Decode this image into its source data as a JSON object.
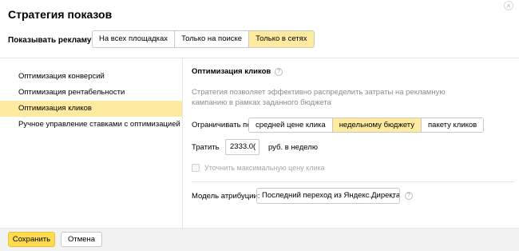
{
  "dialog": {
    "title": "Стратегия показов",
    "close_glyph": "×"
  },
  "placement": {
    "label": "Показывать рекламу:",
    "options": [
      "На всех площадках",
      "Только на поиске",
      "Только в сетях"
    ],
    "selected": "Только в сетях"
  },
  "sidebar": {
    "items": [
      {
        "label": "Оптимизация конверсий"
      },
      {
        "label": "Оптимизация рентабельности"
      },
      {
        "label": "Оптимизация кликов"
      },
      {
        "label": "Ручное управление ставками с оптимизацией"
      }
    ],
    "selected": "Оптимизация кликов"
  },
  "content": {
    "title": "Оптимизация кликов",
    "help_glyph": "?",
    "description": "Стратегия позволяет эффективно распределить затраты на рекламную кампанию в рамках заданного бюджета",
    "limit": {
      "label": "Ограничивать по",
      "options": [
        "средней цене клика",
        "недельному бюджету",
        "пакету кликов"
      ],
      "selected": "недельному бюджету"
    },
    "spend": {
      "label": "Тратить",
      "value": "2333.0(",
      "unit": "руб. в неделю"
    },
    "refine_checkbox": {
      "label": "Уточнить максимальную цену клика",
      "checked": false,
      "disabled": true
    },
    "attribution": {
      "label": "Модель атрибуции:",
      "value": "Последний переход из Яндекс.Директа",
      "chevron_glyph": "⌄",
      "help_glyph": "?"
    }
  },
  "footer": {
    "save_label": "Сохранить",
    "cancel_label": "Отмена"
  },
  "colors": {
    "accent_yellow": "#ffdb4d",
    "selected_bg": "#ffeba0",
    "border": "#c8c8c8",
    "muted_text": "#8c8c8c"
  }
}
